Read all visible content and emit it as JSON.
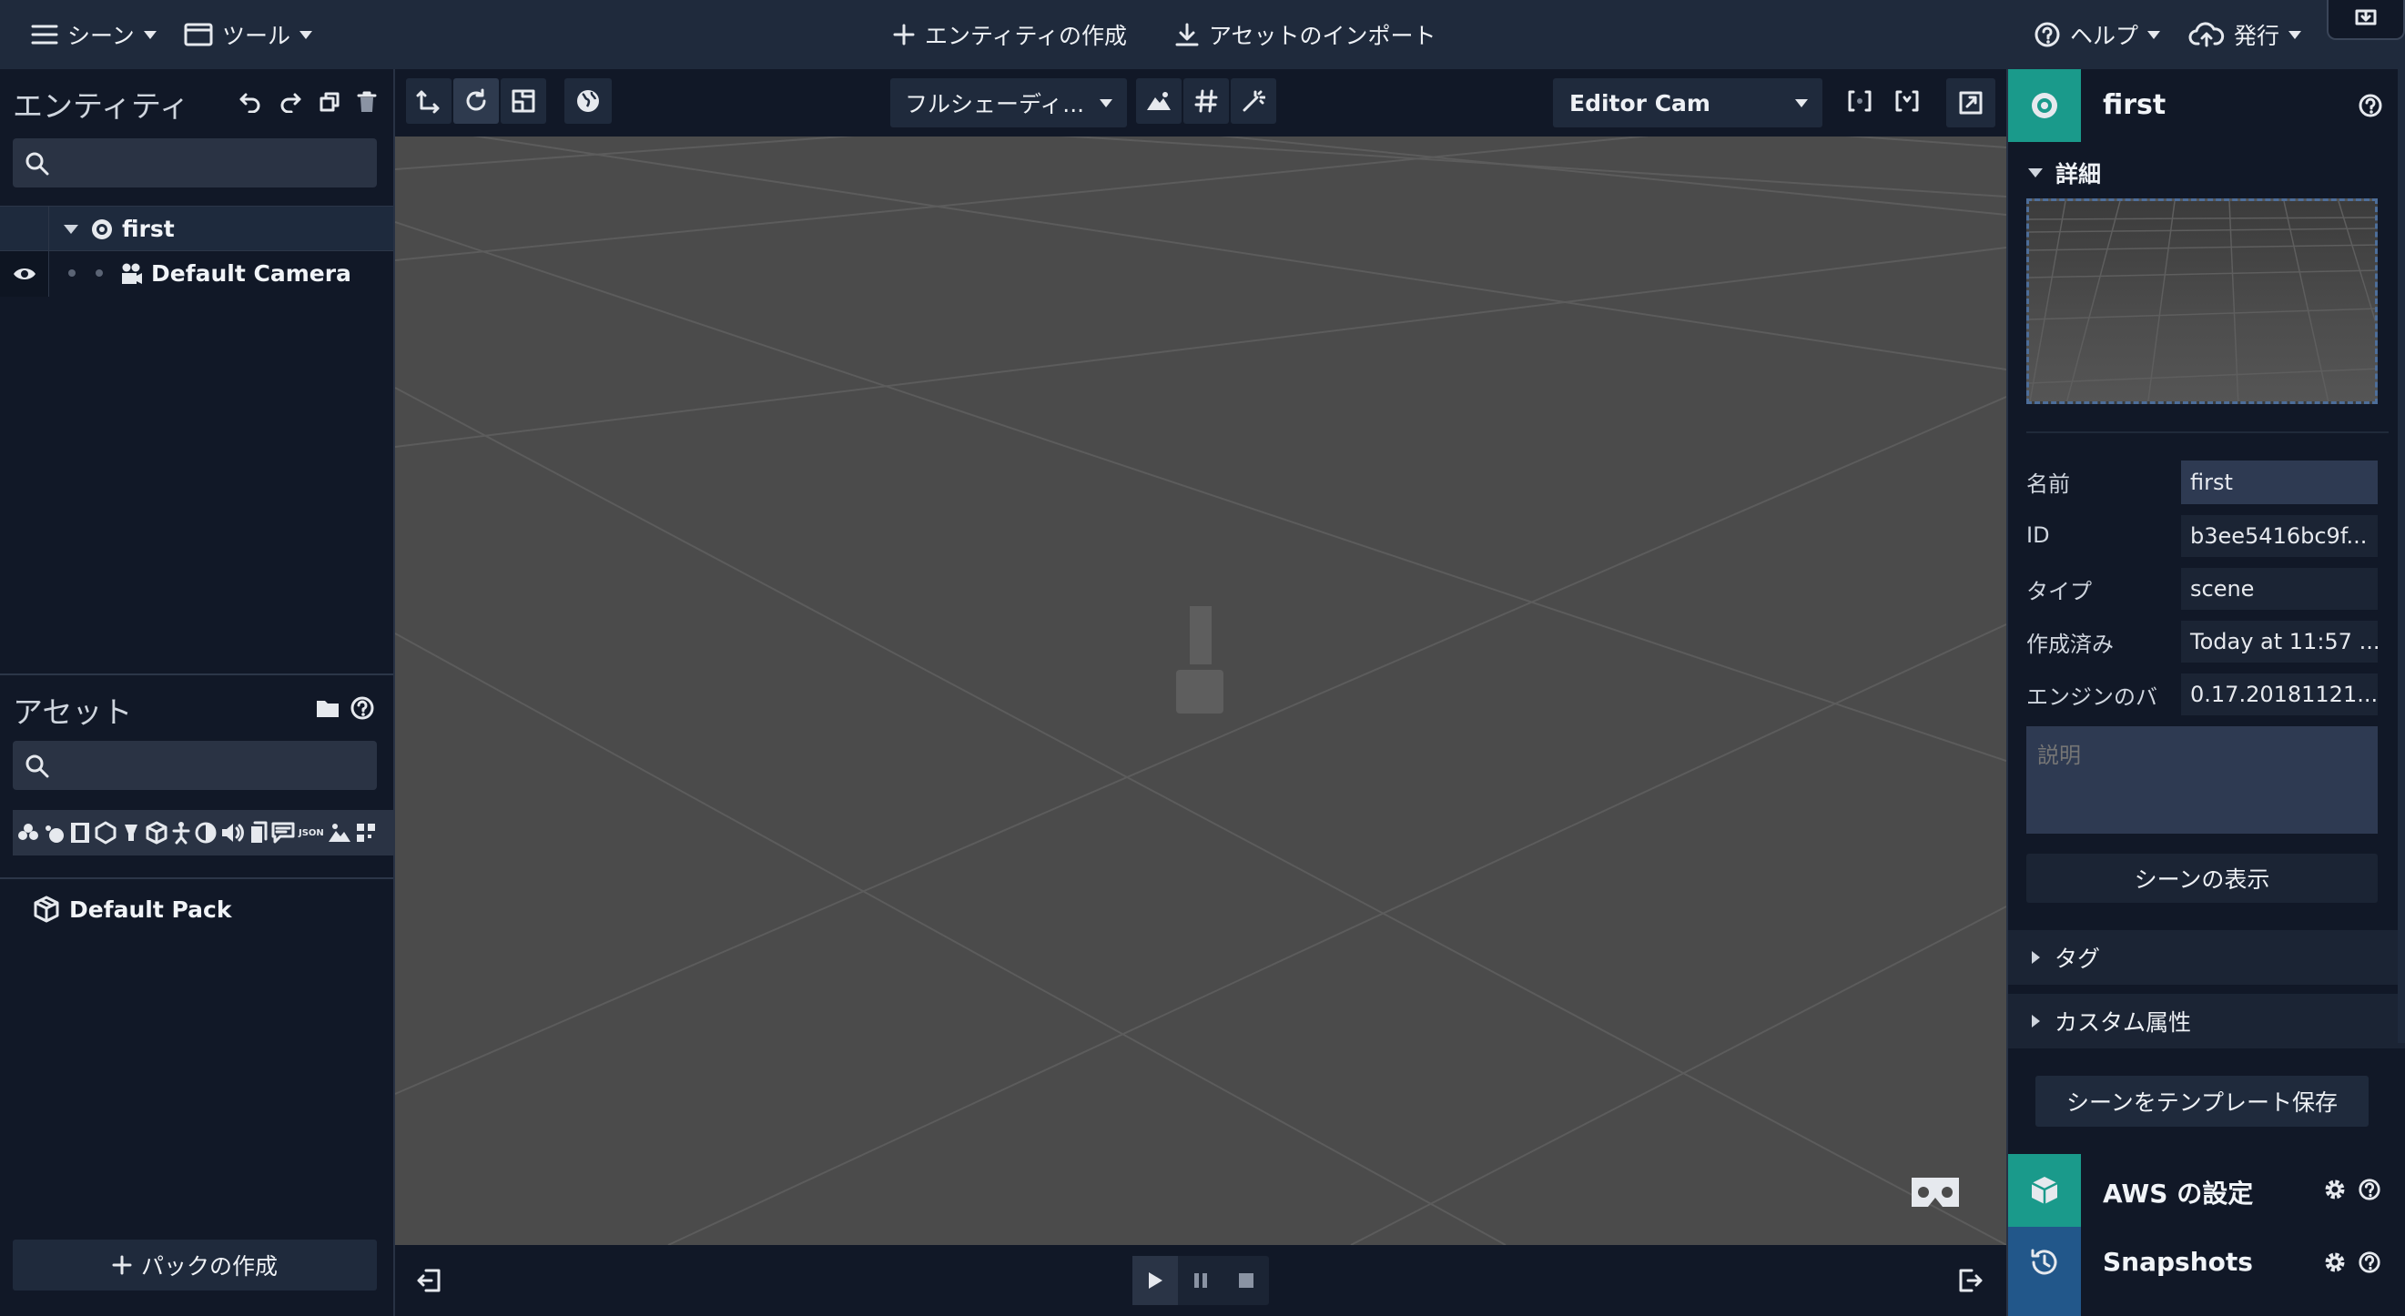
{
  "topbar": {
    "scene_menu": "シーン",
    "tools_menu": "ツール",
    "create_entity": "エンティティの作成",
    "import_assets": "アセットのインポート",
    "help": "ヘルプ",
    "publish": "発行"
  },
  "entities": {
    "title": "エンティティ",
    "search_placeholder": "",
    "tree": [
      {
        "label": "first"
      },
      {
        "label": "Default Camera"
      }
    ]
  },
  "assets": {
    "title": "アセット",
    "search_placeholder": "",
    "packs": [
      {
        "label": "Default Pack"
      }
    ],
    "create_pack": "パックの作成",
    "json_filter": "JSON"
  },
  "viewport": {
    "shading_mode": "フルシェーディ...",
    "camera": "Editor Cam"
  },
  "inspector": {
    "title": "first",
    "details_header": "詳細",
    "fields": [
      {
        "label": "名前",
        "value": "first"
      },
      {
        "label": "ID",
        "value": "b3ee5416bc9f..."
      },
      {
        "label": "タイプ",
        "value": "scene"
      },
      {
        "label": "作成済み",
        "value": "Today at 11:57 ..."
      },
      {
        "label": "エンジンのバ",
        "value": "0.17.20181121..."
      }
    ],
    "description_placeholder": "説明",
    "show_scene": "シーンの表示",
    "tags_header": "タグ",
    "custom_attr_header": "カスタム属性",
    "save_template": "シーンをテンプレート保存",
    "aws_settings": "AWS の設定",
    "snapshots": "Snapshots"
  },
  "colors": {
    "accent_teal": "#1a9a8b",
    "accent_blue": "#22578a",
    "background": "#111827",
    "topbar": "#1f2a3c",
    "viewport": "#4b4b4b"
  }
}
